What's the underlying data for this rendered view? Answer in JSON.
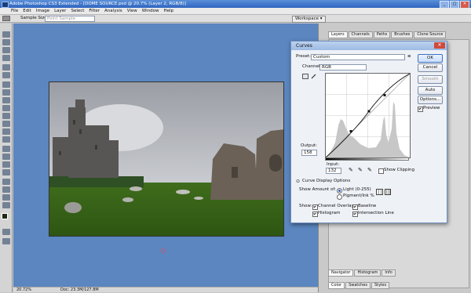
{
  "app": {
    "title": "Adobe Photoshop CS3 Extended - [DOME SOURCE.psd @ 20.7% (Layer 2, RGB/8)]"
  },
  "window": {
    "minimize": "_",
    "maximize": "□",
    "close": "✕"
  },
  "menu": [
    "File",
    "Edit",
    "Image",
    "Layer",
    "Select",
    "Filter",
    "Analysis",
    "View",
    "Window",
    "Help"
  ],
  "options_bar": {
    "sample_size_label": "Sample Size:",
    "sample_size_value": "Point Sample",
    "workspace_label": "Workspace ▾"
  },
  "panels": {
    "top_tabs": [
      "Layers",
      "Channels",
      "Paths",
      "Brushes",
      "Clone Source"
    ],
    "nav_tabs": [
      "Navigator",
      "Histogram",
      "Info"
    ],
    "color_tabs": [
      "Color",
      "Swatches",
      "Styles"
    ]
  },
  "status": {
    "zoom": "20.72%",
    "doc": "Doc: 23.3M/127.8M"
  },
  "curves": {
    "title": "Curves",
    "preset_label": "Preset:",
    "preset_value": "Custom",
    "channel_label": "Channel:",
    "channel_value": "RGB",
    "output_label": "Output:",
    "output_value": "158",
    "input_label": "Input:",
    "input_value": "132",
    "show_clipping": "Show Clipping",
    "display_options": "Curve Display Options",
    "show_amount_label": "Show Amount of:",
    "light_option": "Light (0-255)",
    "pigment_option": "Pigment/Ink %",
    "show_label": "Show:",
    "channel_overlays": "Channel Overlays",
    "baseline": "Baseline",
    "histogram": "Histogram",
    "intersection_line": "Intersection Line",
    "buttons": {
      "ok": "OK",
      "cancel": "Cancel",
      "smooth": "Smooth",
      "auto": "Auto",
      "options": "Options..."
    },
    "preview": "Preview"
  },
  "colors": {
    "canvas": "#5b86bf",
    "titlebar": "#2f65c0",
    "accent": "#3c73c4"
  }
}
